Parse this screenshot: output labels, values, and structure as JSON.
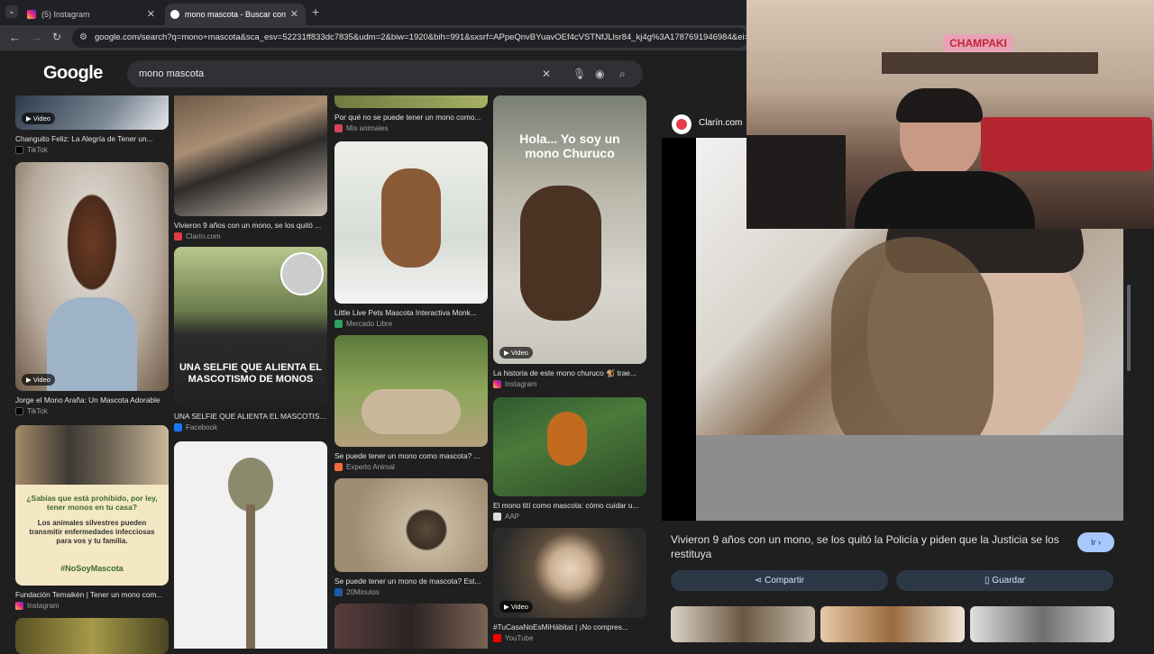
{
  "browser": {
    "tabs": [
      {
        "title": "(5) Instagram"
      },
      {
        "title": "mono mascota - Buscar con Go"
      }
    ],
    "url": "google.com/search?q=mono+mascota&sca_esv=52231ff833dc7835&udm=2&biw=1920&bih=991&sxsrf=APpeQnvBYuavOEf4cVSTNfJLlsr84_kj4g%3A1787691946984&ei=qgC"
  },
  "google": {
    "logo": "Google",
    "query": "mono mascota"
  },
  "results": {
    "col1": [
      {
        "caption": "Changuito Feliz: La Alegría de Tener un...",
        "source": "TikTok",
        "badge": "Video"
      },
      {
        "caption": "Jorge el Mono Araña: Un Mascota Adorable",
        "source": "TikTok",
        "badge": "Video"
      },
      {
        "caption": "Fundación Temaikèn | Tener un mono com...",
        "source": "Instagram",
        "overlay_q": "¿Sabías que está prohibido, por ley, tener monos en tu casa?",
        "overlay_body": "Los animales silvestres pueden transmitir enfermedades infecciosas para vos y tu familia.",
        "overlay_tag": "#NoSoyMascota"
      }
    ],
    "col2": [
      {
        "caption": "Vivieron 9 años con un mono, se los quitó ...",
        "source": "Clarín.com"
      },
      {
        "caption": "UNA SELFIE QUE ALIENTA EL MASCOTISM...",
        "source": "Facebook",
        "overlay": "UNA SELFIE QUE ALIENTA EL MASCOTISMO DE MONOS"
      }
    ],
    "col3": [
      {
        "caption": "Por qué no se puede tener un mono como...",
        "source": "Mis animales"
      },
      {
        "caption": "Little Live Pets Mascota Interactiva Monk...",
        "source": "Mercado Libre"
      },
      {
        "caption": "Se puede tener un mono como mascota? ...",
        "source": "Experto Animal"
      },
      {
        "caption": "Se puede tener un mono de mascota? Est...",
        "source": "20Minutos"
      }
    ],
    "col4": [
      {
        "caption": "La historia de este mono churuco 🐒 trae...",
        "source": "Instagram",
        "badge": "Video",
        "overlay": "Hola... Yo soy un mono Churuco"
      },
      {
        "caption": "El mono tití como mascota: cómo cuidar u...",
        "source": "AAP"
      },
      {
        "caption": "#TuCasaNoEsMiHábitat | ¡No compres...",
        "source": "YouTube",
        "badge": "Video"
      }
    ]
  },
  "panel": {
    "source": "Clarín.com",
    "title": "Vivieron 9 años con un mono, se los quitó la Policía y piden que la Justicia se los restituya",
    "go_label": "Ir",
    "share_label": "Compartir",
    "save_label": "Guardar"
  },
  "webcam": {
    "sign": "CHAMPAKI"
  },
  "colors": {
    "accent": "#a8c7fa",
    "background": "#1f1f1f"
  }
}
